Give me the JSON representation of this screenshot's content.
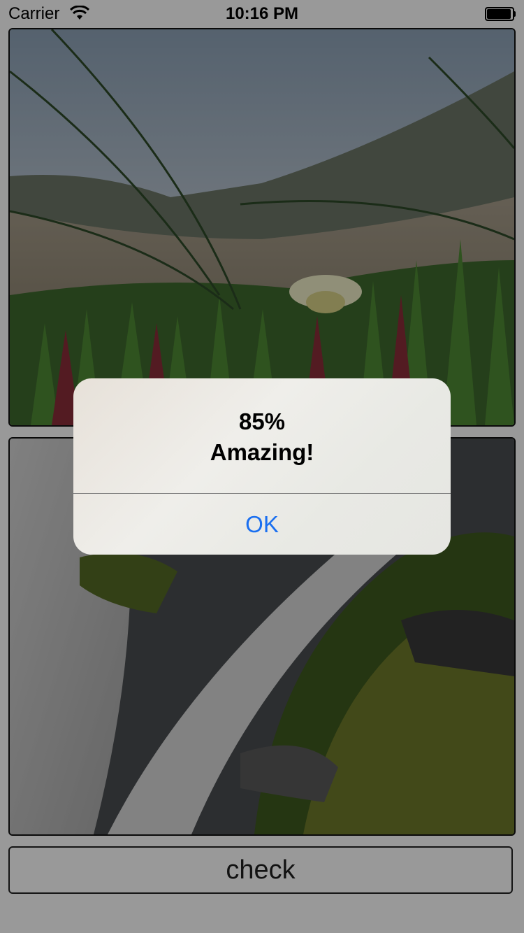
{
  "status_bar": {
    "carrier": "Carrier",
    "time": "10:16 PM",
    "wifi_icon": "wifi-icon",
    "battery_icon": "battery-icon"
  },
  "images": {
    "top": {
      "icon": "photo-icon"
    },
    "bottom": {
      "icon": "photo-icon"
    }
  },
  "check_button": {
    "label": "check"
  },
  "alert": {
    "title": "85%",
    "message": "Amazing!",
    "ok_label": "OK"
  },
  "colors": {
    "accent": "#1a6ff0",
    "overlay": "rgba(0,0,0,0.4)"
  }
}
